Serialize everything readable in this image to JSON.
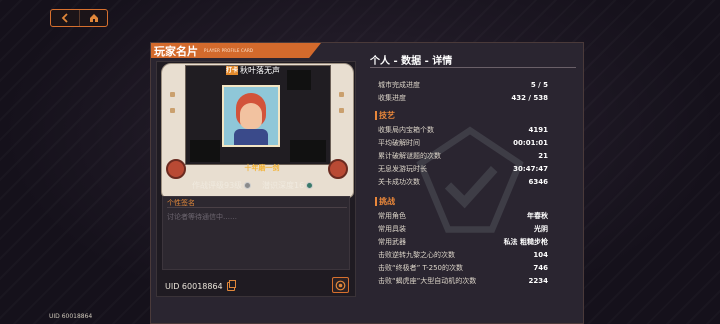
{
  "nav": {
    "back_icon": "back-arrow-icon",
    "home_icon": "home-icon"
  },
  "bottom_uid": "UID 60018864",
  "card": {
    "title": "玩家名片",
    "subtitle": "PLAYER PROFILE CARD",
    "tag": "打卡",
    "screen_name": "秋叶落无声",
    "banner": "十年磨一剑",
    "rank_label": "作战评级93级",
    "depth_label": "潜识深度16",
    "signature_label": "个性签名",
    "signature_placeholder": "讨论者等待通信中……",
    "uid": "UID 60018864"
  },
  "stats": {
    "title": "个人 - 数据 - 详情",
    "top_rows": [
      {
        "label": "城市完成进度",
        "value": "5 / 5"
      },
      {
        "label": "收集进度",
        "value": "432 / 538"
      }
    ],
    "skills_title": "技艺",
    "skills": [
      {
        "label": "收集局内宝箱个数",
        "value": "4191"
      },
      {
        "label": "平均破解时间",
        "value": "00:01:01"
      },
      {
        "label": "累计破解谜题的次数",
        "value": "21"
      },
      {
        "label": "无息发游玩时长",
        "value": "30:47:47"
      },
      {
        "label": "关卡成功次数",
        "value": "6346"
      }
    ],
    "challenge_title": "挑战",
    "challenges": [
      {
        "label": "常用角色",
        "value": "年春秋"
      },
      {
        "label": "常用具装",
        "value": "光阴"
      },
      {
        "label": "常用武器",
        "value": "私法 粗糙步枪"
      },
      {
        "label": "击败逆转九黎之心的次数",
        "value": "104"
      },
      {
        "label": "击败“终极者” T-250的次数",
        "value": "746"
      },
      {
        "label": "击败“蝎虎座”大型自动机的次数",
        "value": "2234"
      }
    ]
  },
  "colors": {
    "accent": "#d36a2c",
    "panel": "#2a2530"
  }
}
